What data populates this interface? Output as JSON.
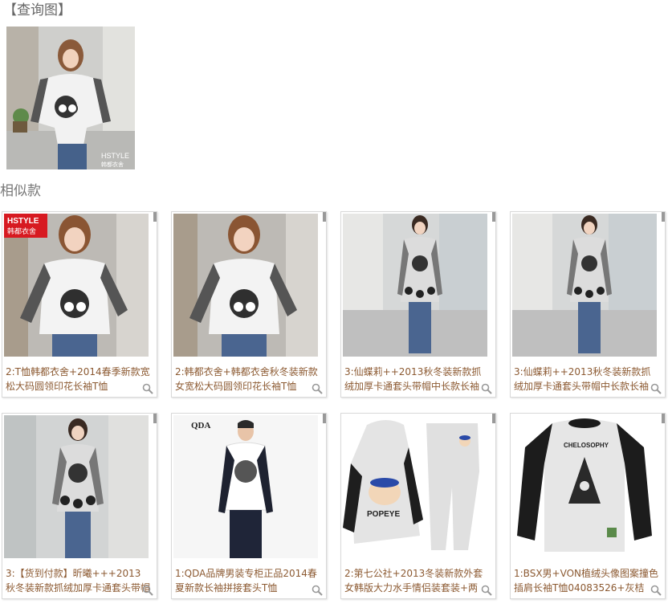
{
  "query": {
    "title": "【查询图】",
    "image_text": "HSTYLE\n韩都衣舍"
  },
  "similar": {
    "title": "相似款",
    "items": [
      {
        "caption": "2:T恤韩都衣舍+2014春季新款宽松大码圆领印花长袖T恤",
        "badge_line1": "HSTYLE",
        "badge_line2": "韩都衣舍"
      },
      {
        "caption": "2:韩都衣舍+韩都衣舍秋冬装新款女宽松大码圆领印花长袖T恤"
      },
      {
        "caption": "3:仙蝶莉++2013秋冬装新款抓绒加厚卡通套头带帽中长款长袖"
      },
      {
        "caption": "3:仙蝶莉++2013秋冬装新款抓绒加厚卡通套头带帽中长款长袖"
      },
      {
        "caption": "3:【货到付款】昕曦+++2013秋冬装新款抓绒加厚卡通套头带帽"
      },
      {
        "caption": "1:QDA品牌男装专柜正品2014春夏新款长袖拼接套头T恤",
        "brand": "QDA"
      },
      {
        "caption": "2:第七公社+2013冬装新款外套女韩版大力水手情侣装套装+两",
        "print_text": "POPEYE"
      },
      {
        "caption": "1:BSX男+VON植绒头像图案撞色插肩长袖T恤04083526+灰桔",
        "print_text": "CHELOSOPHY"
      }
    ]
  }
}
